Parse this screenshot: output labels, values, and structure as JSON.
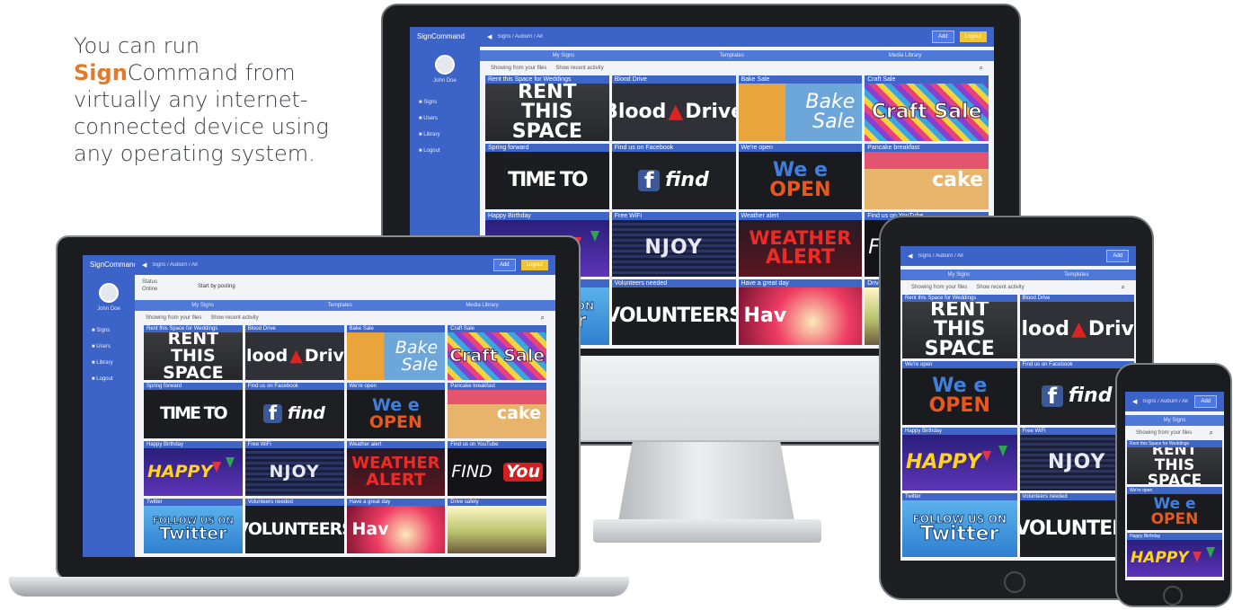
{
  "tagline": {
    "line1": "You can run",
    "brand_bold": "Sign",
    "brand_rest": "Command from",
    "line3": "virtually any internet-",
    "line4": "connected device using",
    "line5": "any operating system."
  },
  "app": {
    "logo": "SignCommand",
    "user_name": "John Doe",
    "nav_items": [
      "Signs",
      "Users",
      "Library",
      "Logout"
    ],
    "breadcrumb": "Signs / Auburn / All",
    "add_button": "Add",
    "logout_button": "Logout",
    "tabs": [
      "My Signs",
      "Templates",
      "Media Library"
    ],
    "search_left": "Showing from your files",
    "search_mid": "Show recent activity",
    "laptop_status_lines": [
      "Status",
      "Online"
    ],
    "laptop_schedule": "Start by posting"
  },
  "tiles": [
    {
      "title": "Rent this Space for Weddings",
      "art": "rent",
      "text1": "RENT",
      "text2": "THIS SPACE"
    },
    {
      "title": "Blood Drive",
      "art": "blood",
      "text1": "Blood",
      "text2": "Drive"
    },
    {
      "title": "Bake Sale",
      "art": "bake",
      "text1": "Bake",
      "text2": "Sale"
    },
    {
      "title": "Craft Sale",
      "art": "craft",
      "text1": "Craft Sale",
      "text2": ""
    },
    {
      "title": "Spring forward",
      "art": "time",
      "text1": "TIME TO",
      "text2": ""
    },
    {
      "title": "Find us on Facebook",
      "art": "fb",
      "text1": "f",
      "text2": "find"
    },
    {
      "title": "We're open",
      "art": "open",
      "text1": "We e",
      "text2": "OPEN"
    },
    {
      "title": "Pancake breakfast",
      "art": "cake",
      "text1": "cake",
      "text2": ""
    },
    {
      "title": "Happy Birthday",
      "art": "happy",
      "text1": "HAPPY",
      "text2": ""
    },
    {
      "title": "Free WiFi",
      "art": "enjoy",
      "text1": "NJOY",
      "text2": ""
    },
    {
      "title": "Weather alert",
      "art": "weather",
      "text1": "WEATHER",
      "text2": "ALERT"
    },
    {
      "title": "Find us on YouTube",
      "art": "find",
      "text1": "FIND",
      "text2": "You"
    },
    {
      "title": "Twitter",
      "art": "twitter",
      "text1": "FOLLOW US ON",
      "text2": "Twitter"
    },
    {
      "title": "Volunteers needed",
      "art": "vol",
      "text1": "VOLUNTEERS",
      "text2": ""
    },
    {
      "title": "Have a great day",
      "art": "great",
      "text1": "Hav",
      "text2": ""
    },
    {
      "title": "Drive safely",
      "art": "drive",
      "text1": "",
      "text2": ""
    }
  ],
  "tablet_tiles": [
    {
      "title": "Rent this Space for Weddings",
      "art": "rent",
      "text1": "RENT",
      "text2": "THIS SPACE"
    },
    {
      "title": "Blood Drive",
      "art": "blood",
      "text1": "Blood",
      "text2": "Drive"
    },
    {
      "title": "We're open",
      "art": "open",
      "text1": "We e",
      "text2": "OPEN"
    },
    {
      "title": "Find us on Facebook",
      "art": "fb",
      "text1": "f",
      "text2": "find"
    },
    {
      "title": "Happy Birthday",
      "art": "happy",
      "text1": "HAPPY",
      "text2": ""
    },
    {
      "title": "Free WiFi",
      "art": "enjoy",
      "text1": "NJOY",
      "text2": ""
    },
    {
      "title": "Twitter",
      "art": "twitter",
      "text1": "FOLLOW US ON",
      "text2": "Twitter"
    },
    {
      "title": "Volunteers needed",
      "art": "vol",
      "text1": "VOLUNTEER",
      "text2": ""
    }
  ],
  "phone_tiles": [
    {
      "title": "Rent this Space for Weddings",
      "art": "rent",
      "text1": "RENT",
      "text2": "THIS SPACE"
    },
    {
      "title": "We're open",
      "art": "open",
      "text1": "We e",
      "text2": "OPEN"
    },
    {
      "title": "Happy Birthday",
      "art": "happy",
      "text1": "HAPPY",
      "text2": ""
    }
  ],
  "colors": {
    "accent": "#3c64c8",
    "tile_header": "#3f66c7",
    "brand_orange": "#e07a2e",
    "logout": "#f0c330"
  }
}
